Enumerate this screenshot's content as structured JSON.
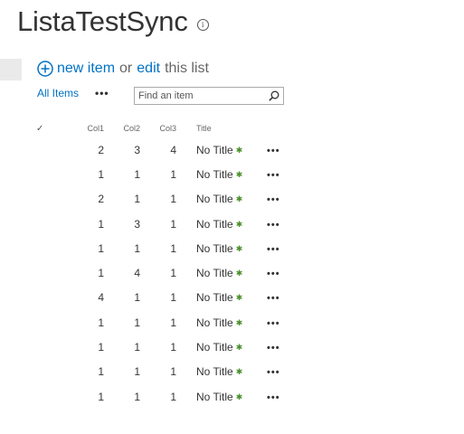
{
  "page": {
    "title": "ListaTestSync",
    "info_glyph": "i"
  },
  "commands": {
    "new_item": "new item",
    "or": "or",
    "edit": "edit",
    "this_list": "this list"
  },
  "view": {
    "label": "All Items",
    "ellipsis": "•••"
  },
  "search": {
    "placeholder": "Find an item",
    "value": ""
  },
  "columns": {
    "check": "✓",
    "col1": "Col1",
    "col2": "Col2",
    "col3": "Col3",
    "title": "Title"
  },
  "rows": [
    {
      "col1": "2",
      "col2": "3",
      "col3": "4",
      "title": "No Title",
      "badge": "✱",
      "menu": "•••"
    },
    {
      "col1": "1",
      "col2": "1",
      "col3": "1",
      "title": "No Title",
      "badge": "✱",
      "menu": "•••"
    },
    {
      "col1": "2",
      "col2": "1",
      "col3": "1",
      "title": "No Title",
      "badge": "✱",
      "menu": "•••"
    },
    {
      "col1": "1",
      "col2": "3",
      "col3": "1",
      "title": "No Title",
      "badge": "✱",
      "menu": "•••"
    },
    {
      "col1": "1",
      "col2": "1",
      "col3": "1",
      "title": "No Title",
      "badge": "✱",
      "menu": "•••"
    },
    {
      "col1": "1",
      "col2": "4",
      "col3": "1",
      "title": "No Title",
      "badge": "✱",
      "menu": "•••"
    },
    {
      "col1": "4",
      "col2": "1",
      "col3": "1",
      "title": "No Title",
      "badge": "✱",
      "menu": "•••"
    },
    {
      "col1": "1",
      "col2": "1",
      "col3": "1",
      "title": "No Title",
      "badge": "✱",
      "menu": "•••"
    },
    {
      "col1": "1",
      "col2": "1",
      "col3": "1",
      "title": "No Title",
      "badge": "✱",
      "menu": "•••"
    },
    {
      "col1": "1",
      "col2": "1",
      "col3": "1",
      "title": "No Title",
      "badge": "✱",
      "menu": "•••"
    },
    {
      "col1": "1",
      "col2": "1",
      "col3": "1",
      "title": "No Title",
      "badge": "✱",
      "menu": "•••"
    }
  ],
  "colors": {
    "link": "#0072c6",
    "new_badge": "#4a8f2a"
  },
  "icons": {
    "add": "plus-circle-icon",
    "search": "search-icon",
    "info": "info-icon",
    "new": "new-item-badge-icon"
  }
}
